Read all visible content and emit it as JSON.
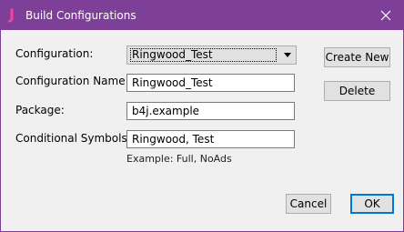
{
  "window": {
    "title": "Build Configurations",
    "app_icon_glyph": "J",
    "accent_color": "#7d3f98",
    "icon_color": "#ff3fa0"
  },
  "form": {
    "configuration": {
      "label": "Configuration:",
      "selected": "Ringwood_Test"
    },
    "configuration_name": {
      "label": "Configuration Name:",
      "value": "Ringwood_Test"
    },
    "package": {
      "label": "Package:",
      "value": "b4j.example"
    },
    "conditional_symbols": {
      "label": "Conditional Symbols:",
      "value": "Ringwood, Test",
      "hint": "Example: Full, NoAds"
    }
  },
  "buttons": {
    "create_new": "Create New",
    "delete": "Delete",
    "cancel": "Cancel",
    "ok": "OK"
  }
}
